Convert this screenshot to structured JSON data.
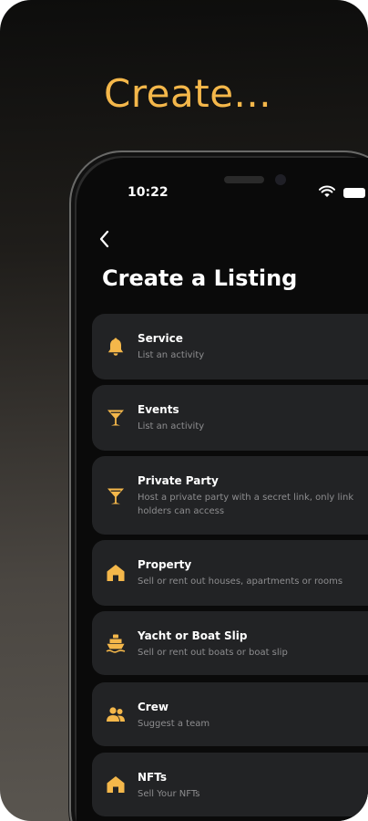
{
  "promo": {
    "headline": "Create..."
  },
  "status_bar": {
    "time": "10:22"
  },
  "page": {
    "title": "Create a Listing"
  },
  "items": [
    {
      "title": "Service",
      "description": "List an activity",
      "icon": "bell-icon"
    },
    {
      "title": "Events",
      "description": "List an activity",
      "icon": "cocktail-glass-icon"
    },
    {
      "title": "Private Party",
      "description": "Host a private party with a secret link, only link holders can access",
      "icon": "cocktail-glass-icon"
    },
    {
      "title": "Property",
      "description": "Sell or rent out houses, apartments or rooms",
      "icon": "house-icon"
    },
    {
      "title": "Yacht or Boat Slip",
      "description": "Sell or rent out boats or boat slip",
      "icon": "boat-icon"
    },
    {
      "title": "Crew",
      "description": "Suggest a team",
      "icon": "team-icon"
    },
    {
      "title": "NFTs",
      "description": "Sell Your NFTs",
      "icon": "house-icon"
    }
  ],
  "colors": {
    "accent": "#f4b74a",
    "card_background": "#222325",
    "screen_background": "#0a0a0a",
    "muted_text": "#8d8d8f"
  }
}
